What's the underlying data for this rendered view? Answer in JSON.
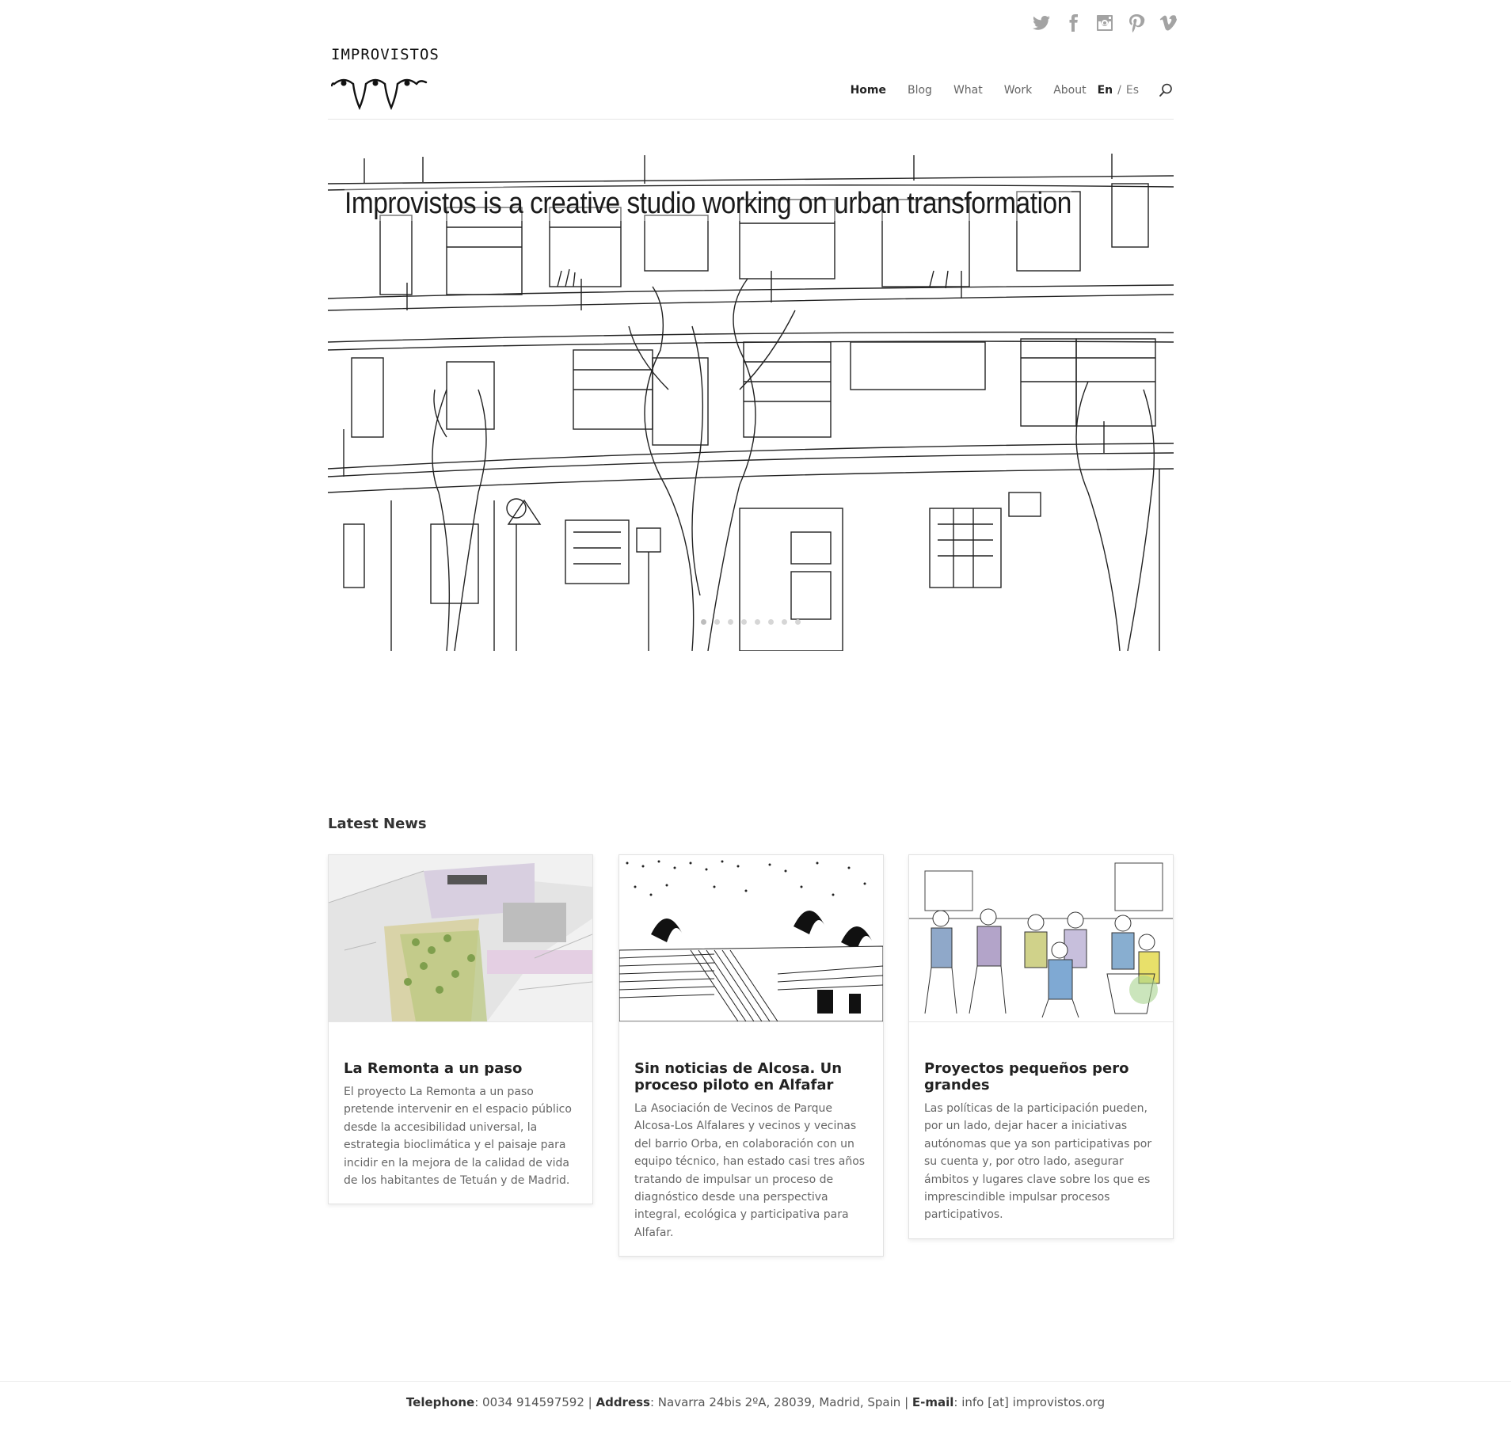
{
  "social": [
    "twitter-icon",
    "facebook-icon",
    "instagram-icon",
    "pinterest-icon",
    "vimeo-icon"
  ],
  "logo": {
    "text": "IMPROVISTOS"
  },
  "nav": {
    "items": [
      "Home",
      "Blog",
      "What",
      "Work",
      "About"
    ],
    "active": "Home",
    "lang_en": "En",
    "lang_sep": "/",
    "lang_es": "Es"
  },
  "hero": {
    "title": "Improvistos is a creative studio working on urban transformation",
    "slides": 8,
    "active_slide": 1
  },
  "news": {
    "heading": "Latest News",
    "posts": [
      {
        "title": "La Remonta a un paso",
        "excerpt": "El proyecto La Remonta a un paso pretende intervenir en el espacio público desde la accesibilidad universal, la estrategia bioclimática y el paisaje para incidir en la mejora de la calidad de vida de los habitantes de Tetuán y de Madrid."
      },
      {
        "title": "Sin noticias de Alcosa. Un proceso piloto en Alfafar",
        "excerpt": "La Asociación de Vecinos de Parque Alcosa-Los Alfalares y vecinos y vecinas del barrio Orba, en colaboración con un equipo técnico, han estado casi tres años tratando de impulsar un proceso de diagnóstico desde una perspectiva integral, ecológica y participativa para Alfafar."
      },
      {
        "title": "Proyectos pequeños pero grandes",
        "excerpt": "Las políticas de la participación pueden, por un lado, dejar hacer a iniciativas autónomas que ya son participativas por su cuenta y, por otro lado, asegurar ámbitos y lugares clave sobre los que es imprescindible impulsar procesos participativos."
      }
    ]
  },
  "footer": {
    "telephone_label": "Telephone",
    "telephone": ": 0034 914597592 | ",
    "address_label": "Address",
    "address": ": Navarra 24bis 2ºA, 28039, Madrid, Spain | ",
    "email_label": "E-mail",
    "email": ": info [at] improvistos.org"
  }
}
